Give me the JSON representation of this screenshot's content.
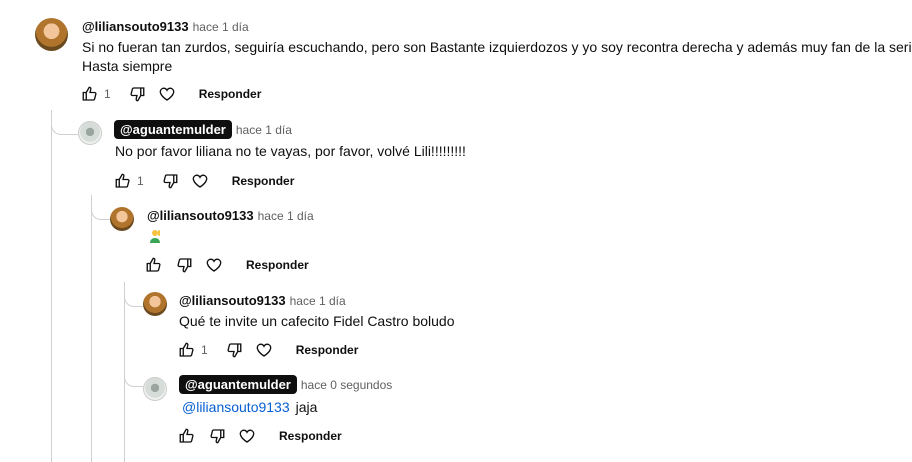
{
  "comments": [
    {
      "author": "@liliansouto9133",
      "owner": false,
      "time": "hace 1 día",
      "text_line1": "Si no fueran tan zurdos, seguiría escuchando, pero son Bastante izquierdozos y yo soy recontra derecha y además muy fan de la serie",
      "text_line2": "Hasta siempre",
      "likes": "1",
      "reply_label": "Responder"
    },
    {
      "author": "@aguantemulder",
      "owner": true,
      "time": "hace 1 día",
      "text": "No por favor liliana no te vayas, por favor, volvé Lili!!!!!!!!!",
      "likes": "1",
      "reply_label": "Responder"
    },
    {
      "author": "@liliansouto9133",
      "owner": false,
      "time": "hace 1 día",
      "emoji": "person-raising-hand-emoji",
      "likes": "",
      "reply_label": "Responder"
    },
    {
      "author": "@liliansouto9133",
      "owner": false,
      "time": "hace 1 día",
      "text": "Qué te invite un cafecito Fidel Castro boludo",
      "likes": "1",
      "reply_label": "Responder"
    },
    {
      "author": "@aguantemulder",
      "owner": true,
      "time": "hace 0 segundos",
      "mention": "@liliansouto9133",
      "text": "jaja",
      "likes": "",
      "reply_label": "Responder"
    }
  ],
  "icons": {
    "like": "thumbs-up-icon",
    "dislike": "thumbs-down-icon",
    "heart": "heart-icon"
  }
}
